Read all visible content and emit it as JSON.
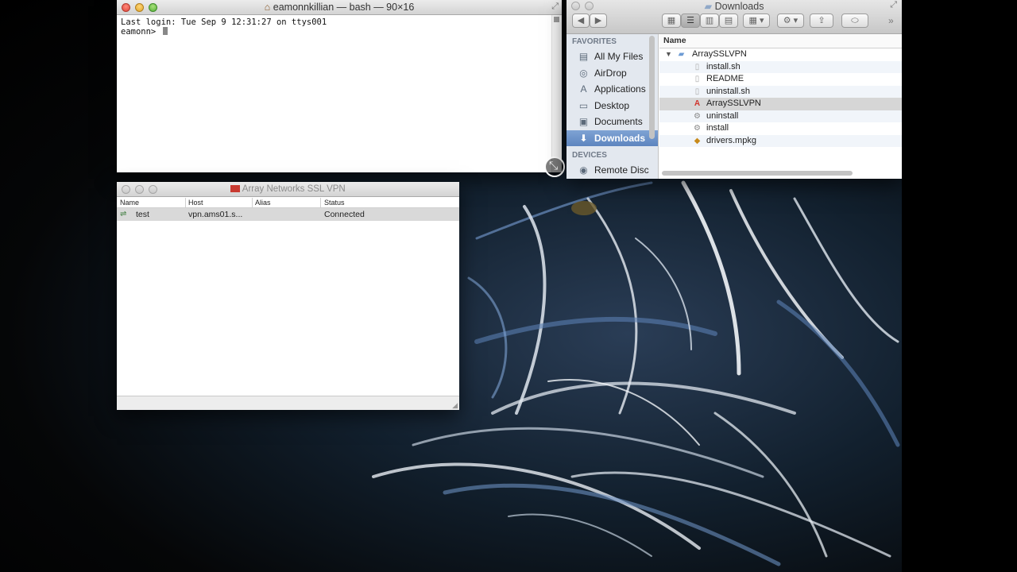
{
  "terminal": {
    "title": "eamonnkillian — bash — 90×16",
    "lines": [
      "Last login: Tue Sep  9 12:31:27 on ttys001",
      "eamonn> "
    ]
  },
  "finder": {
    "title": "Downloads",
    "favorites_header": "FAVORITES",
    "devices_header": "DEVICES",
    "sidebar_items": [
      {
        "label": "All My Files",
        "icon": "all-files-icon"
      },
      {
        "label": "AirDrop",
        "icon": "airdrop-icon"
      },
      {
        "label": "Applications",
        "icon": "applications-icon"
      },
      {
        "label": "Desktop",
        "icon": "desktop-icon"
      },
      {
        "label": "Documents",
        "icon": "documents-icon"
      },
      {
        "label": "Downloads",
        "icon": "downloads-icon",
        "selected": true
      }
    ],
    "device_items": [
      {
        "label": "Remote Disc",
        "icon": "disc-icon"
      }
    ],
    "column_name": "Name",
    "files": [
      {
        "name": "ArraySSLVPN",
        "kind": "folder",
        "expanded": true
      },
      {
        "name": "install.sh",
        "kind": "document"
      },
      {
        "name": "README",
        "kind": "document"
      },
      {
        "name": "uninstall.sh",
        "kind": "document"
      },
      {
        "name": "ArraySSLVPN",
        "kind": "application",
        "highlighted": true
      },
      {
        "name": "uninstall",
        "kind": "script"
      },
      {
        "name": "install",
        "kind": "script"
      },
      {
        "name": "drivers.mpkg",
        "kind": "package"
      }
    ]
  },
  "vpn": {
    "title": "Array Networks SSL VPN",
    "columns": [
      "Name",
      "Host",
      "Alias",
      "Status"
    ],
    "rows": [
      {
        "name": "test",
        "host": "vpn.ams01.s...",
        "alias": "",
        "status": "Connected"
      }
    ]
  },
  "colors": {
    "selection": "#5d85bf",
    "close": "#e0443a",
    "minimize": "#e0a52a",
    "zoom": "#55b23a"
  }
}
